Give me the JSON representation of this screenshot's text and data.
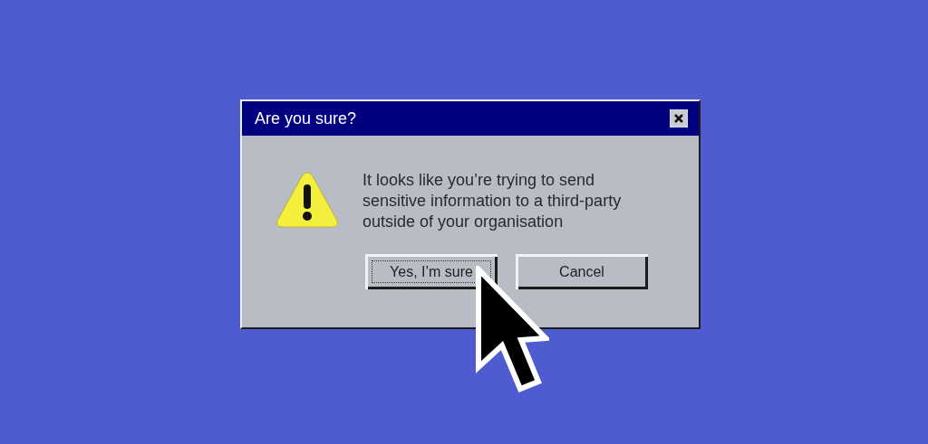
{
  "window": {
    "title": "Are you sure?"
  },
  "message": "It looks like you’re trying to send sensitive information to a third-party outside of your organisation",
  "buttons": [
    {
      "label": "Yes, I’m sure",
      "focused": true
    },
    {
      "label": "Cancel",
      "focused": false
    }
  ]
}
